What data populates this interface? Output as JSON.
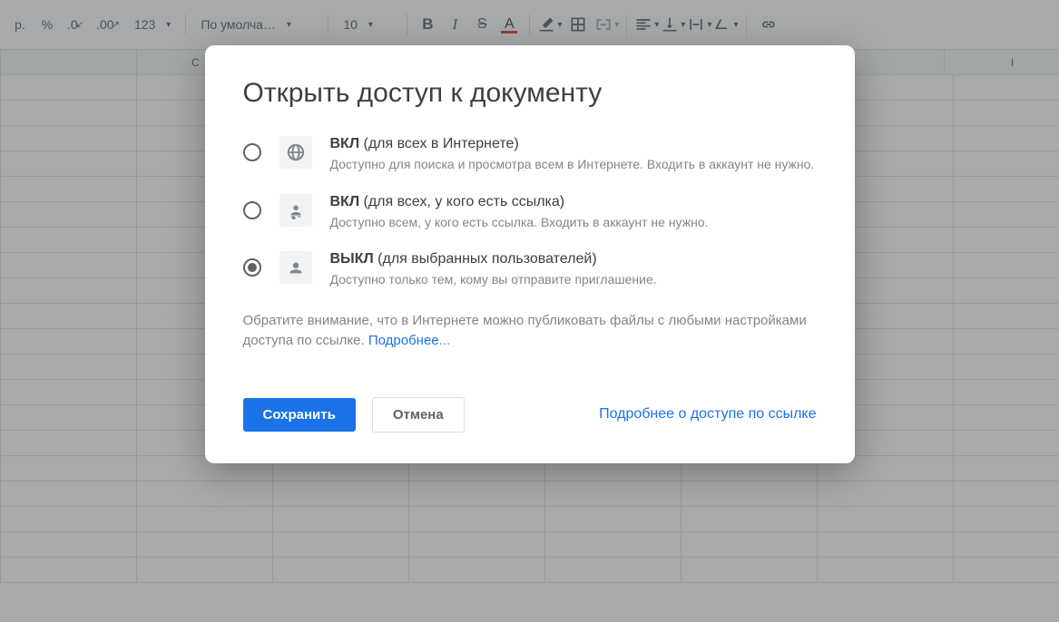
{
  "toolbar": {
    "currency": "p.",
    "percent": "%",
    "dec_decrease": ".0",
    "dec_increase": ".00",
    "format_123": "123",
    "font_select": "По умолча…",
    "font_size": "10",
    "text_color_letter": "A"
  },
  "sheet": {
    "col_C": "C",
    "col_I": "I"
  },
  "dialog": {
    "title": "Открыть доступ к документу",
    "options": [
      {
        "state": "ВКЛ",
        "suffix": " (для всех в Интернете)",
        "desc": "Доступно для поиска и просмотра всем в Интернете. Входить в аккаунт не нужно.",
        "selected": false,
        "icon": "globe"
      },
      {
        "state": "ВКЛ",
        "suffix": " (для всех, у кого есть ссылка)",
        "desc": "Доступно всем, у кого есть ссылка. Входить в аккаунт не нужно.",
        "selected": false,
        "icon": "person-link"
      },
      {
        "state": "ВЫКЛ",
        "suffix": " (для выбранных пользователей)",
        "desc": "Доступно только тем, кому вы отправите приглашение.",
        "selected": true,
        "icon": "person"
      }
    ],
    "notice_text": "Обратите внимание, что в Интернете можно публиковать файлы с любыми настройками доступа по ссылке. ",
    "notice_link": "Подробнее",
    "notice_ellipsis": "...",
    "save": "Сохранить",
    "cancel": "Отмена",
    "footer_link": "Подробнее о доступе по ссылке"
  }
}
